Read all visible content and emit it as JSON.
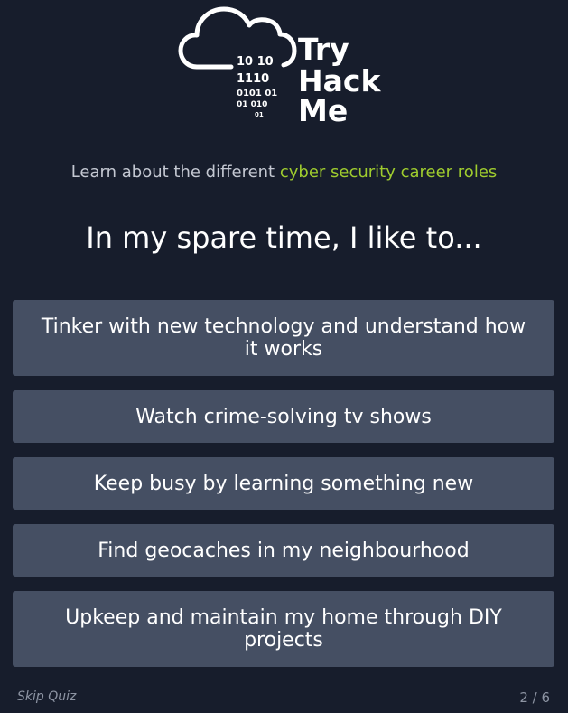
{
  "logo": {
    "binary_lines": [
      "10  10",
      "1110",
      "0101  01",
      "01    010",
      "01"
    ],
    "word_lines": [
      "Try",
      "Hack",
      "Me"
    ]
  },
  "tagline": {
    "prefix": "Learn about the different ",
    "highlight": "cyber security career roles"
  },
  "question": "In my spare time, I like to...",
  "options": [
    "Tinker with new technology and understand how it works",
    "Watch crime-solving tv shows",
    "Keep busy by learning something new",
    "Find geocaches in my neighbourhood",
    "Upkeep and maintain my home through DIY projects"
  ],
  "footer": {
    "skip_label": "Skip Quiz",
    "progress": "2 / 6"
  },
  "colors": {
    "background": "#171d2c",
    "option_bg": "#454f63",
    "accent": "#9fcc2e"
  }
}
